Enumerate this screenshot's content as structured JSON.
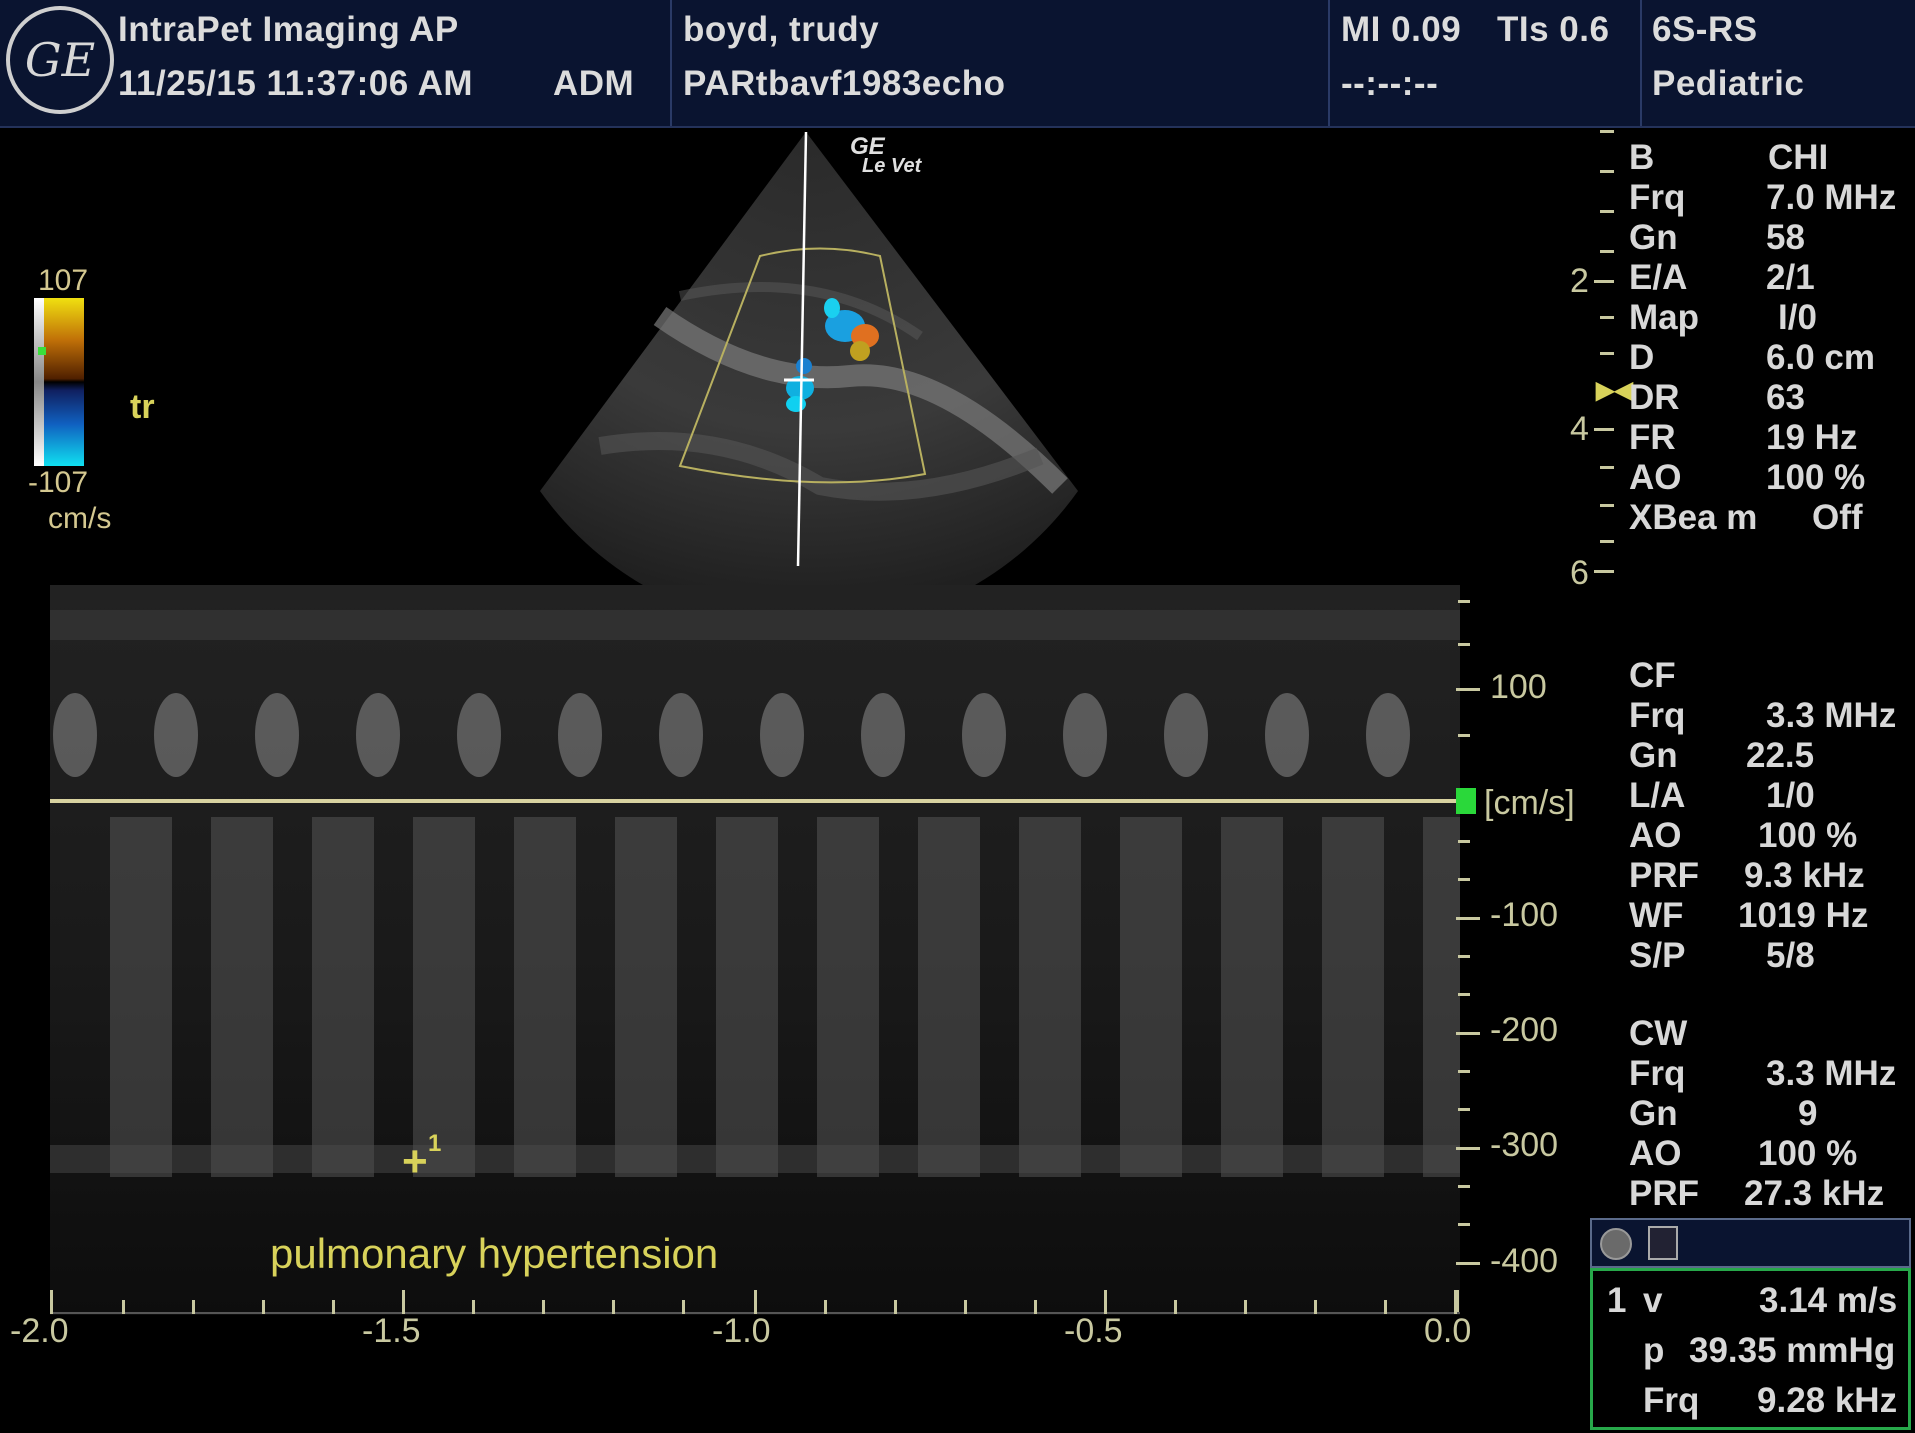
{
  "header": {
    "institution": "IntraPet Imaging AP",
    "datetime": "11/25/15 11:37:06 AM",
    "operator": "ADM",
    "patient_name": "boyd, trudy",
    "exam_id": "PARtbavf1983echo",
    "mi": "MI 0.09",
    "tis": "TIs 0.6",
    "timer": "--:--:--",
    "probe": "6S-RS",
    "preset": "Pediatric",
    "logo": "GE"
  },
  "color_bar": {
    "max": "107",
    "min": "-107",
    "unit": "cm/s",
    "label": "tr"
  },
  "image_watermark": {
    "line1": "GE",
    "line2": "Le Vet"
  },
  "depth_scale": [
    "2",
    "4",
    "6"
  ],
  "b_params": {
    "title": {
      "k": "B",
      "v": "CHI"
    },
    "rows": [
      {
        "k": "Frq",
        "v": "7.0 MHz"
      },
      {
        "k": "Gn",
        "v": "58"
      },
      {
        "k": "E/A",
        "v": "2/1"
      },
      {
        "k": "Map",
        "v": "I/0"
      },
      {
        "k": "D",
        "v": "6.0 cm"
      },
      {
        "k": "DR",
        "v": "63"
      },
      {
        "k": "FR",
        "v": "19 Hz"
      },
      {
        "k": "AO",
        "v": "100 %"
      },
      {
        "k": "XBea m",
        "v": "Off"
      }
    ]
  },
  "cf_params": {
    "title": "CF",
    "rows": [
      {
        "k": "Frq",
        "v": "3.3 MHz"
      },
      {
        "k": "Gn",
        "v": "22.5"
      },
      {
        "k": "L/A",
        "v": "1/0"
      },
      {
        "k": "AO",
        "v": "100 %"
      },
      {
        "k": "PRF",
        "v": "9.3 kHz"
      },
      {
        "k": "WF",
        "v": "1019 Hz"
      },
      {
        "k": "S/P",
        "v": "5/8"
      }
    ]
  },
  "cw_params": {
    "title": "CW",
    "rows": [
      {
        "k": "Frq",
        "v": "3.3 MHz"
      },
      {
        "k": "Gn",
        "v": "9"
      },
      {
        "k": "AO",
        "v": "100 %"
      },
      {
        "k": "PRF",
        "v": "27.3 kHz"
      }
    ]
  },
  "doppler": {
    "velocity_ticks": [
      "100",
      "-100",
      "-200",
      "-300",
      "-400"
    ],
    "unit": "[cm/s]",
    "time_ticks": [
      "-2.0",
      "-1.5",
      "-1.0",
      "-0.5",
      "0.0"
    ],
    "annotation": "pulmonary hypertension",
    "cursor_label": "1"
  },
  "measurement": {
    "index": "1",
    "v_label": "v",
    "v_value": "3.14 m/s",
    "p_label": "p",
    "p_value": "39.35 mmHg",
    "frq_label": "Frq",
    "frq_value": "9.28 kHz"
  },
  "colors": {
    "header_bg": "#0a1430",
    "label_yellow": "#d8d25a",
    "scale_tan": "#c8c8a0",
    "measure_border": "#27a84a"
  }
}
